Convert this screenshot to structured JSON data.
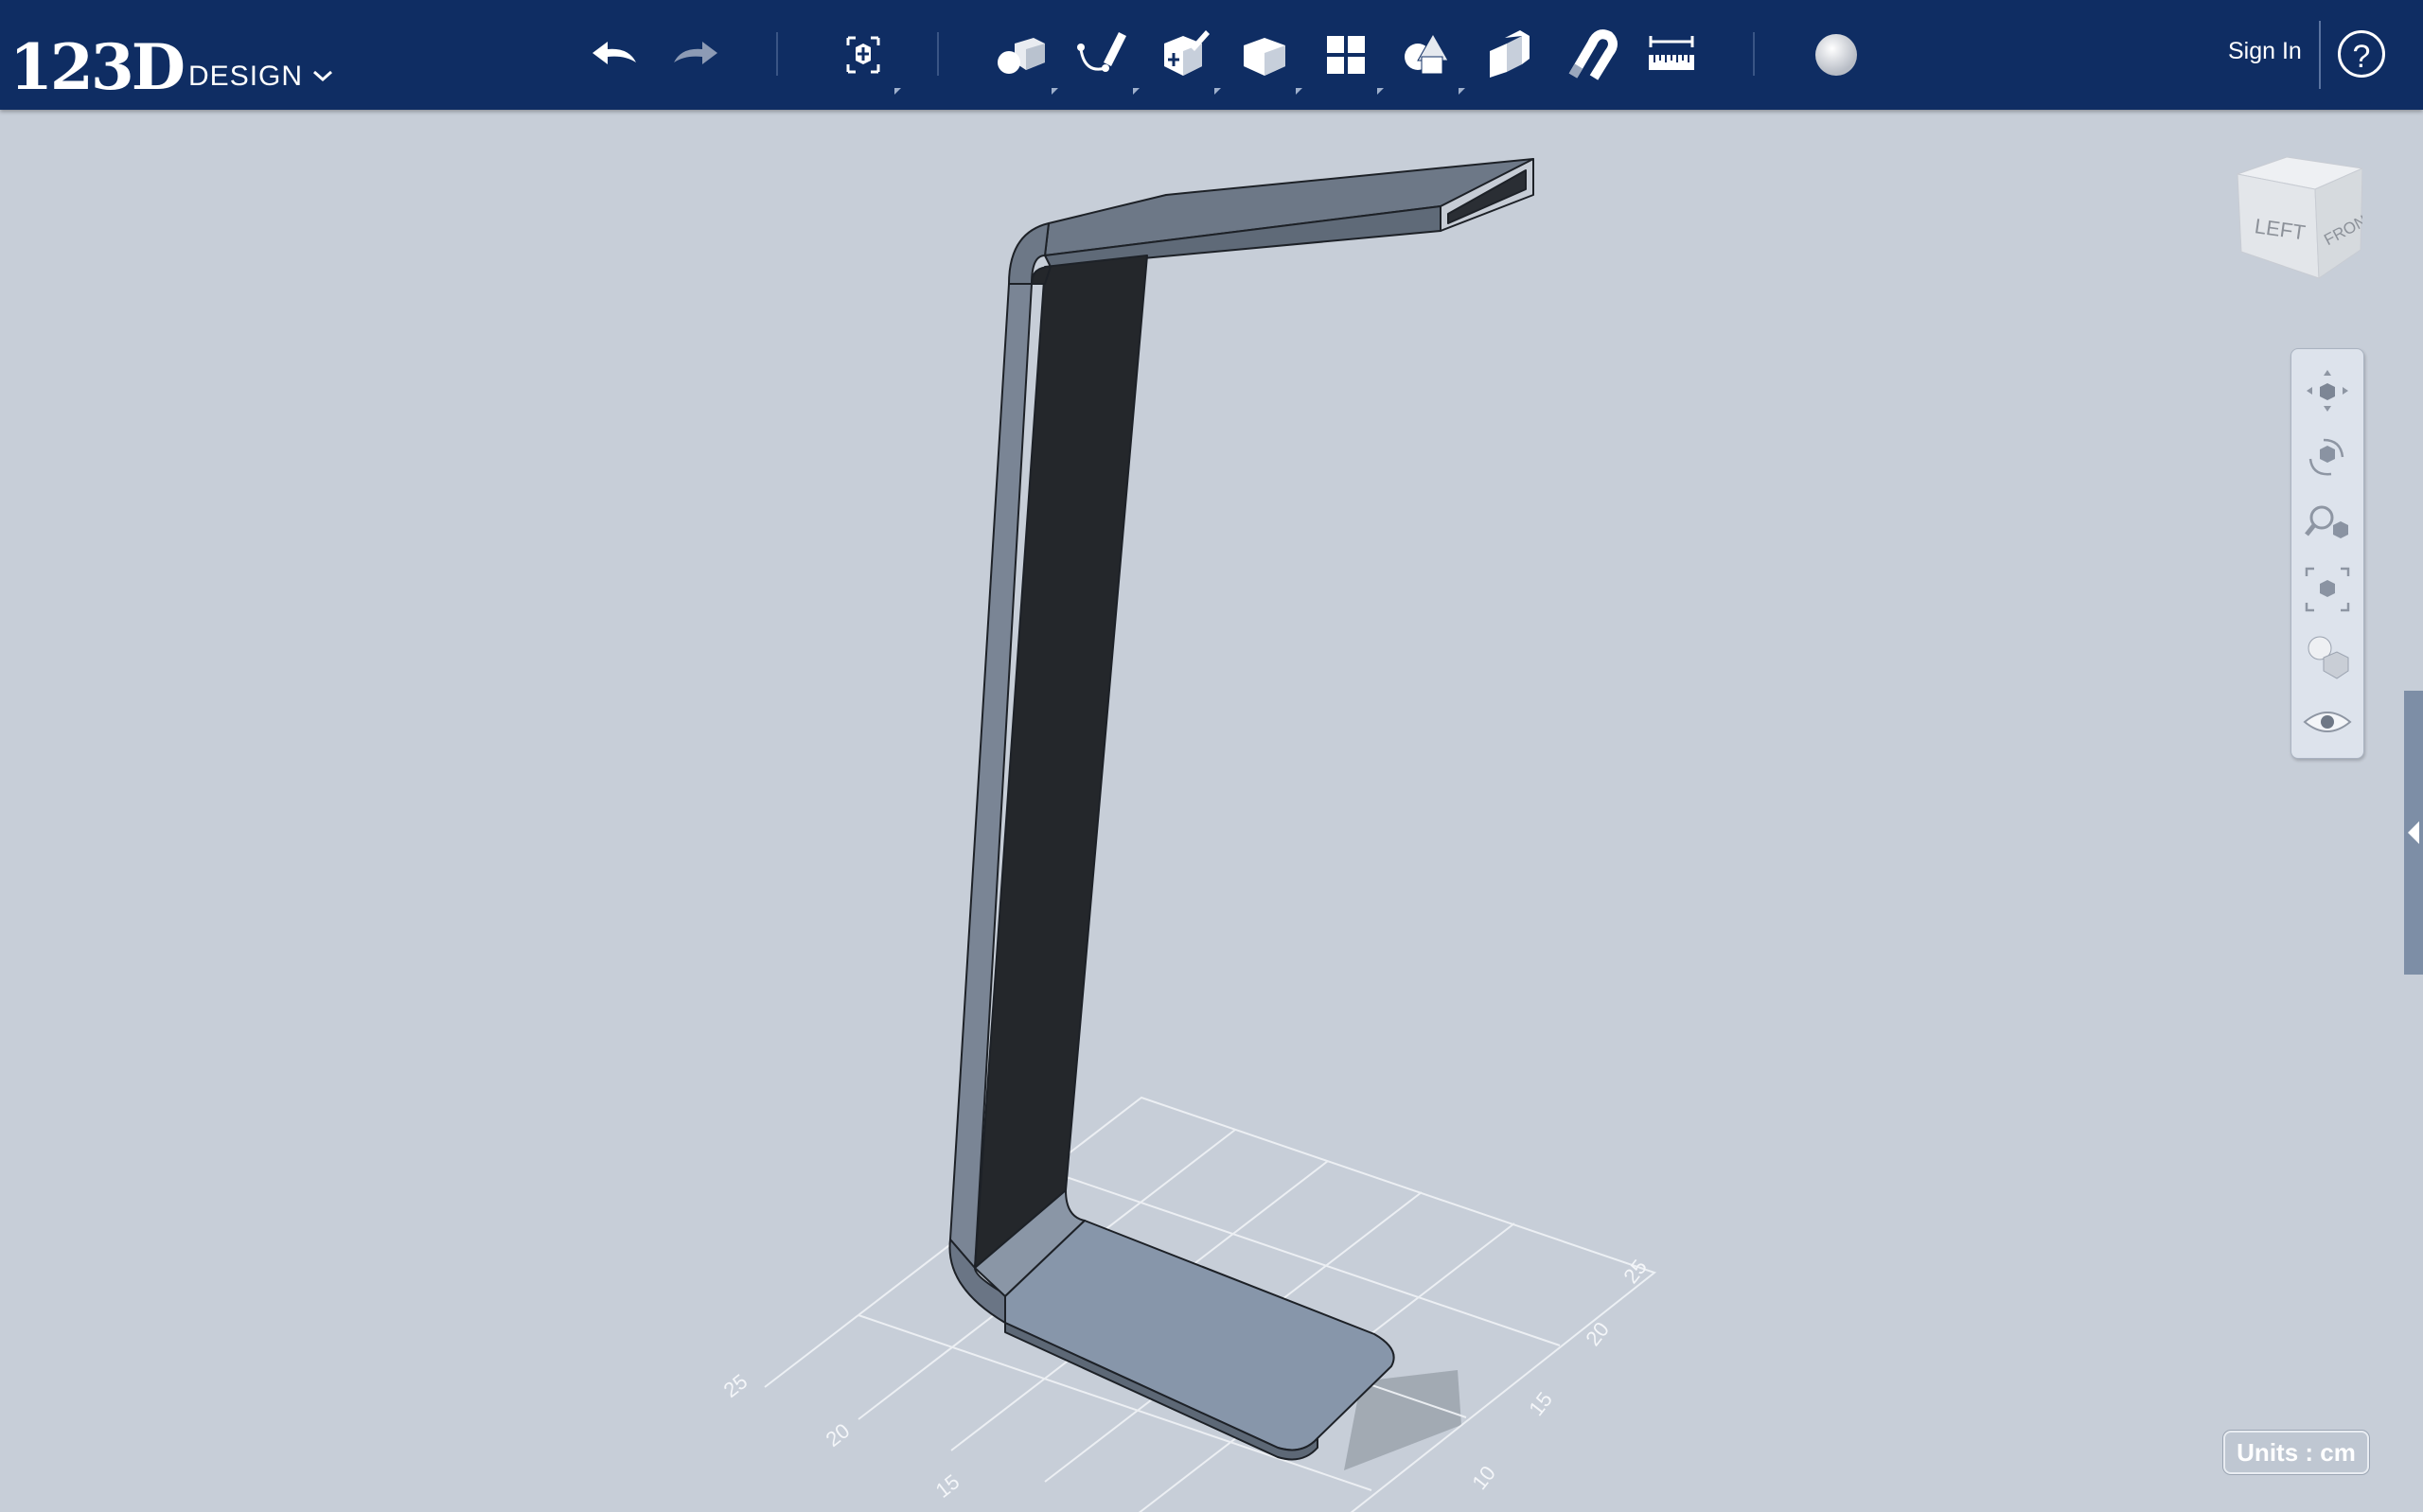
{
  "app": {
    "logo_number": "123D",
    "logo_word": "DESIGN"
  },
  "toolbar": {
    "tools": [
      {
        "name": "undo-icon"
      },
      {
        "name": "redo-icon"
      },
      {
        "name": "transform-icon"
      },
      {
        "name": "primitives-icon"
      },
      {
        "name": "sketch-icon"
      },
      {
        "name": "construct-icon"
      },
      {
        "name": "modify-icon"
      },
      {
        "name": "pattern-icon"
      },
      {
        "name": "grouping-icon"
      },
      {
        "name": "combine-icon"
      },
      {
        "name": "snap-icon"
      },
      {
        "name": "measure-icon"
      },
      {
        "name": "material-icon"
      }
    ],
    "sign_in": "Sign In",
    "help": "?"
  },
  "viewcube": {
    "left": "LEFT",
    "front": "FRONT"
  },
  "navigation": {
    "items": [
      "pan-icon",
      "orbit-icon",
      "zoom-icon",
      "fit-icon",
      "view-mode-icon",
      "visibility-icon"
    ]
  },
  "units": "Units : cm",
  "grid": {
    "labels_left": [
      "25",
      "20",
      "15"
    ],
    "labels_right": [
      "25",
      "20",
      "15",
      "10"
    ]
  },
  "colors": {
    "toolbar_bg": "#0f2d63",
    "viewport_bg": "#c7ced8",
    "model_face": "#5f6b79",
    "model_inner": "#25282c",
    "model_base": "#8696a8"
  }
}
